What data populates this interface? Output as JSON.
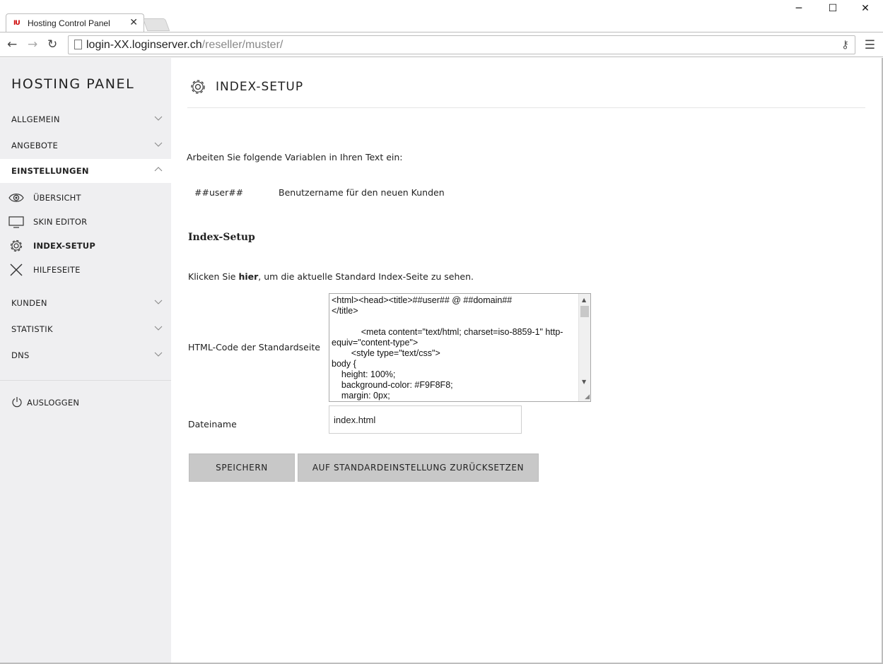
{
  "browser": {
    "tab_title": "Hosting Control Panel",
    "tab_close": "✕",
    "favicon": "\"IU",
    "url_host": "login-XX.loginserver.ch",
    "url_path": "/reseller/muster/"
  },
  "sidebar": {
    "brand": "HOSTING PANEL",
    "sections": [
      {
        "label": "ALLGEMEIN",
        "expanded": false
      },
      {
        "label": "ANGEBOTE",
        "expanded": false
      },
      {
        "label": "EINSTELLUNGEN",
        "expanded": true
      },
      {
        "label": "KUNDEN",
        "expanded": false
      },
      {
        "label": "STATISTIK",
        "expanded": false
      },
      {
        "label": "DNS",
        "expanded": false
      }
    ],
    "subitems": [
      {
        "label": "ÜBERSICHT",
        "icon": "eye-icon"
      },
      {
        "label": "SKIN EDITOR",
        "icon": "monitor-icon"
      },
      {
        "label": "INDEX-SETUP",
        "icon": "gear-icon",
        "current": true
      },
      {
        "label": "HILFESEITE",
        "icon": "cross-icon"
      }
    ],
    "logout_label": "AUSLOGGEN"
  },
  "main": {
    "page_title": "INDEX-SETUP",
    "intro": "Arbeiten Sie folgende Variablen in Ihren Text ein:",
    "variables": [
      {
        "code": "##user##",
        "description": "Benutzername für den neuen Kunden"
      }
    ],
    "section_title": "Index-Setup",
    "click_prefix": "Klicken Sie ",
    "click_link": "hier",
    "click_suffix": ", um die aktuelle Standard Index-Seite zu sehen.",
    "html_label": "HTML-Code der Standardseite",
    "html_code": "<html><head><title>##user## @ ##domain##\n</title>\n\n            <meta content=\"text/html; charset=iso-8859-1\" http-equiv=\"content-type\">\n        <style type=\"text/css\">\nbody {\n    height: 100%;\n    background-color: #F9F8F8;\n    margin: 0px;",
    "filename_label": "Dateiname",
    "filename_value": "index.html",
    "save_label": "SPEICHERN",
    "reset_label": "AUF STANDARDEINSTELLUNG ZURÜCKSETZEN"
  }
}
